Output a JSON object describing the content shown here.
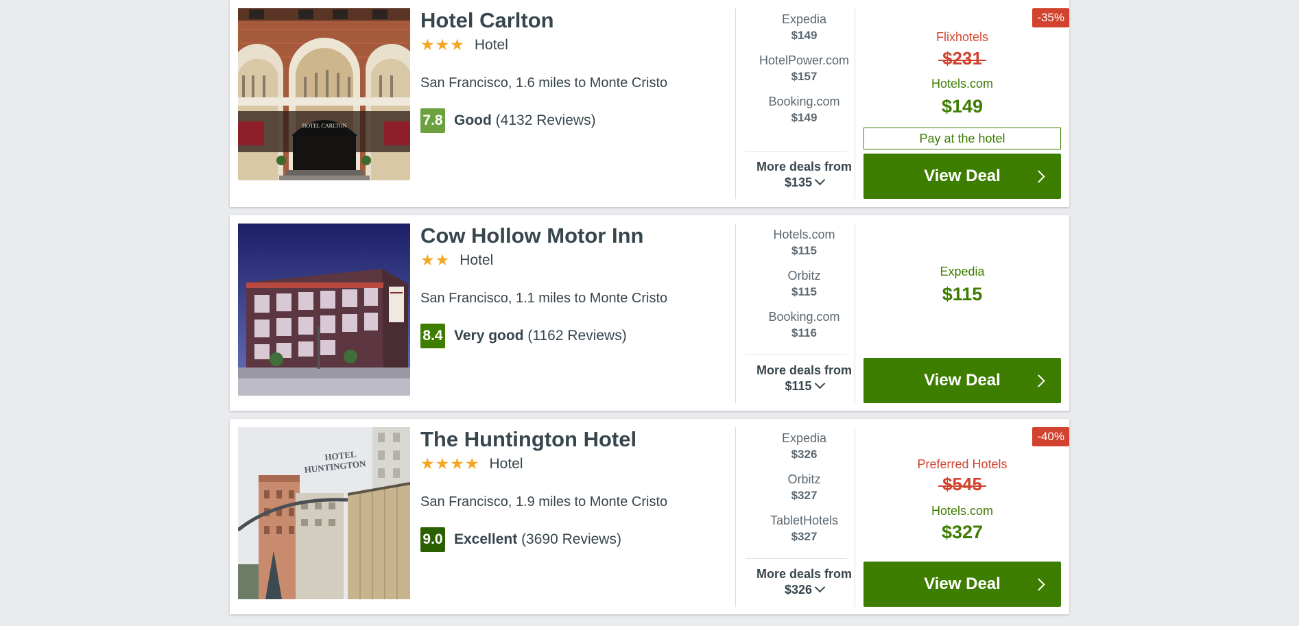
{
  "hotels": [
    {
      "name": "Hotel Carlton",
      "stars": "★★★",
      "type": "Hotel",
      "location": "San Francisco, 1.6 miles to Monte Cristo",
      "score": "7.8",
      "score_color": "#6ba13f",
      "rating_label": "Good",
      "reviews": "(4132 Reviews)",
      "offers": [
        {
          "name": "Expedia",
          "price": "$149"
        },
        {
          "name": "HotelPower.com",
          "price": "$157"
        },
        {
          "name": "Booking.com",
          "price": "$149"
        }
      ],
      "more_label": "More deals from",
      "more_price": "$135",
      "badge": "-35%",
      "crossed_provider": "Flixhotels",
      "crossed_price": "$231",
      "best_provider": "Hotels.com",
      "best_price": "$149",
      "pay_at_hotel": "Pay at the hotel",
      "cta": "View Deal",
      "photo_text": "HOTEL CARLTON"
    },
    {
      "name": "Cow Hollow Motor Inn",
      "stars": "★★",
      "type": "Hotel",
      "location": "San Francisco, 1.1 miles to Monte Cristo",
      "score": "8.4",
      "score_color": "#3d7d00",
      "rating_label": "Very good",
      "reviews": "(1162 Reviews)",
      "offers": [
        {
          "name": "Hotels.com",
          "price": "$115"
        },
        {
          "name": "Orbitz",
          "price": "$115"
        },
        {
          "name": "Booking.com",
          "price": "$116"
        }
      ],
      "more_label": "More deals from",
      "more_price": "$115",
      "best_provider": "Expedia",
      "best_price": "$115",
      "cta": "View Deal"
    },
    {
      "name": "The Huntington Hotel",
      "stars": "★★★★",
      "type": "Hotel",
      "location": "San Francisco, 1.9 miles to Monte Cristo",
      "score": "9.0",
      "score_color": "#2b6000",
      "rating_label": "Excellent",
      "reviews": "(3690 Reviews)",
      "offers": [
        {
          "name": "Expedia",
          "price": "$326"
        },
        {
          "name": "Orbitz",
          "price": "$327"
        },
        {
          "name": "TabletHotels",
          "price": "$327"
        }
      ],
      "more_label": "More deals from",
      "more_price": "$326",
      "badge": "-40%",
      "crossed_provider": "Preferred Hotels",
      "crossed_price": "$545",
      "best_provider": "Hotels.com",
      "best_price": "$327",
      "cta": "View Deal",
      "photo_text_1": "HOTEL",
      "photo_text_2": "HUNTINGTON"
    }
  ]
}
